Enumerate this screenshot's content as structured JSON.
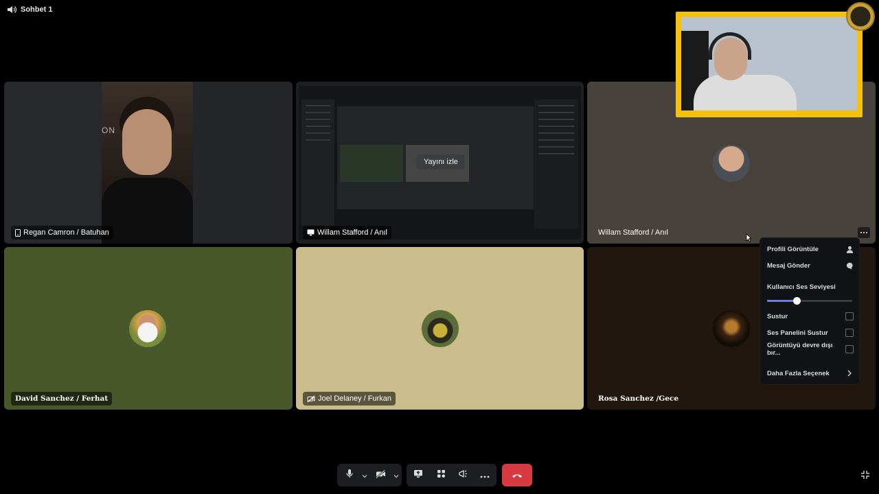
{
  "topbar": {
    "icon": "speaker-icon",
    "title": "Sohbet 1"
  },
  "tiles": [
    {
      "name": "Regan Camron / Batuhan",
      "icon": "mobile-icon",
      "camera_text": "ON"
    },
    {
      "name": "Willam Stafford / Anıl",
      "icon": "screen-icon",
      "watch_label": "Yayını izle"
    },
    {
      "name": "Willam Stafford / Anıl"
    },
    {
      "name": "David Sanchez / Ferhat"
    },
    {
      "name": "Joel Delaney / Furkan",
      "icon": "video-off-icon"
    },
    {
      "name": "Rosa Sanchez /Gece"
    }
  ],
  "menu": {
    "items": [
      {
        "label": "Profili Görüntüle",
        "icon": "user-icon"
      },
      {
        "label": "Mesaj Gönder",
        "icon": "chat-bubble-icon"
      }
    ],
    "volume_label": "Kullanıcı Ses Seviyesi",
    "volume_level": 0.35,
    "checks": [
      {
        "label": "Sustur",
        "checked": false
      },
      {
        "label": "Ses Panelini Sustur",
        "checked": false
      },
      {
        "label": "Görüntüyü devre dışı bır...",
        "checked": false
      }
    ],
    "more": {
      "label": "Daha Fazla Seçenek",
      "icon": "chevron-right-icon"
    }
  },
  "controls": [
    "microphone-icon",
    "chevron-down-icon",
    "camera-off-icon",
    "chevron-down-icon",
    "screen-share-icon",
    "activities-icon",
    "soundboard-icon",
    "more-icon",
    "hang-up-icon"
  ],
  "colors": {
    "hangup": "#d83a42",
    "slider": "#6e7ce8",
    "pip_border": "#f4c20d"
  }
}
